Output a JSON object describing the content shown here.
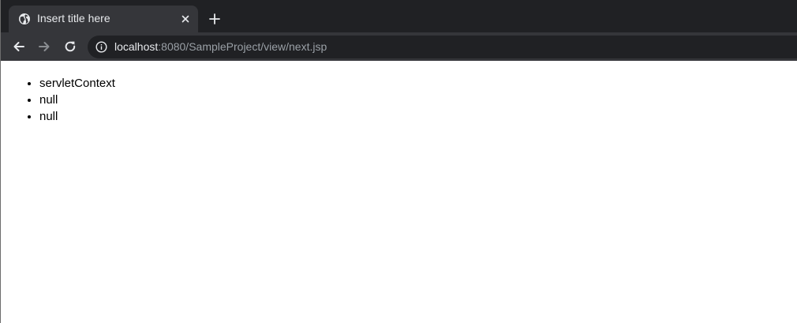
{
  "browser": {
    "tab": {
      "title": "Insert title here",
      "favicon": "globe-icon"
    },
    "address": {
      "host": "localhost",
      "rest": ":8080/SampleProject/view/next.jsp"
    }
  },
  "page": {
    "items": [
      "servletContext",
      "null",
      "null"
    ]
  },
  "colors": {
    "tabstrip": "#202124",
    "toolbar": "#35363a",
    "omnibox": "#202124",
    "text_light": "#e8eaed",
    "text_dim": "#9aa0a6"
  }
}
